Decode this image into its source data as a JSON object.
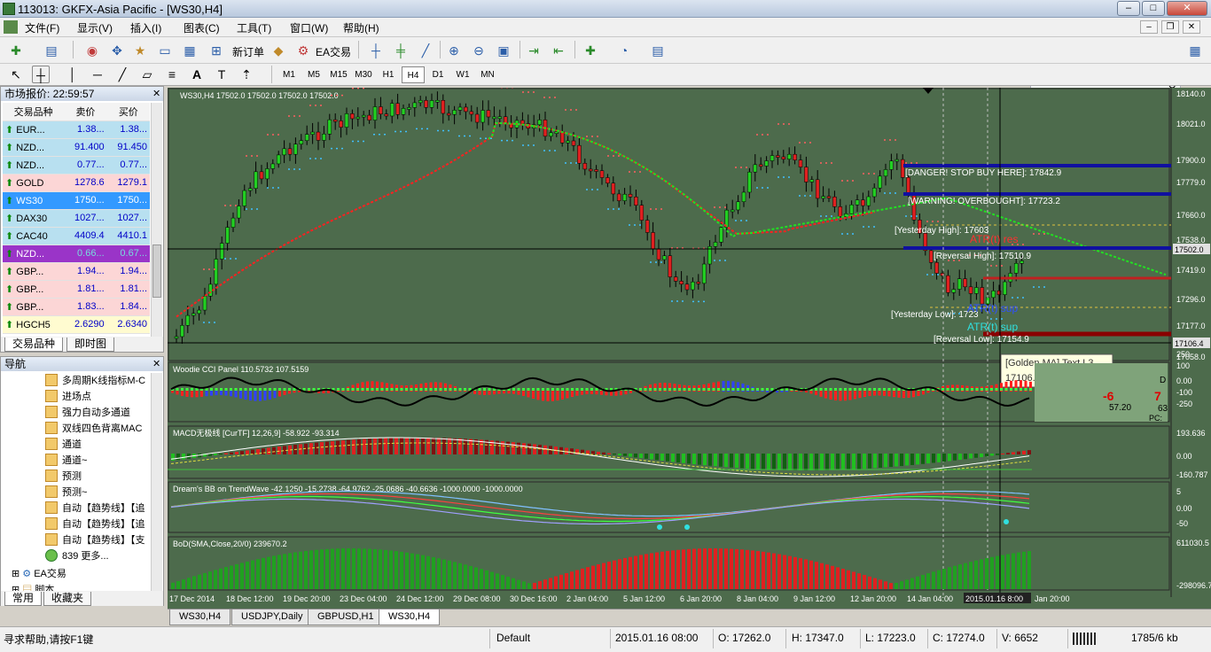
{
  "title": "113013: GKFX-Asia Pacific - [WS30,H4]",
  "menu": [
    "文件(F)",
    "显示(V)",
    "插入(I)",
    "图表(C)",
    "工具(T)",
    "窗口(W)",
    "帮助(H)"
  ],
  "toolbar": {
    "new_order": "新订单",
    "ea_trading": "EA交易"
  },
  "timeframes": [
    "M1",
    "M5",
    "M15",
    "M30",
    "H1",
    "H4",
    "D1",
    "W1",
    "MN"
  ],
  "market_watch": {
    "title": "市场报价: 22:59:57",
    "columns": [
      "交易品种",
      "卖价",
      "买价"
    ],
    "rows": [
      {
        "symbol": "EUR...",
        "bid": "1.38...",
        "ask": "1.38...",
        "bg": "#b8e0f0"
      },
      {
        "symbol": "NZD...",
        "bid": "91.400",
        "ask": "91.450",
        "bg": "#b8e0f0"
      },
      {
        "symbol": "NZD...",
        "bid": "0.77...",
        "ask": "0.77...",
        "bg": "#b8e0f0"
      },
      {
        "symbol": "GOLD",
        "bid": "1278.6",
        "ask": "1279.1",
        "bg": "#fcd6d6"
      },
      {
        "symbol": "WS30",
        "bid": "1750...",
        "ask": "1750...",
        "bg": "#3399ff"
      },
      {
        "symbol": "DAX30",
        "bid": "1027...",
        "ask": "1027...",
        "bg": "#b8e0f0"
      },
      {
        "symbol": "CAC40",
        "bid": "4409.4",
        "ask": "4410.1",
        "bg": "#b8e0f0"
      },
      {
        "symbol": "NZD...",
        "bid": "0.66...",
        "ask": "0.67...",
        "bg": "#9a34c8"
      },
      {
        "symbol": "GBP...",
        "bid": "1.94...",
        "ask": "1.94...",
        "bg": "#fcd6d6"
      },
      {
        "symbol": "GBP...",
        "bid": "1.81...",
        "ask": "1.81...",
        "bg": "#fcd6d6"
      },
      {
        "symbol": "GBP...",
        "bid": "1.83...",
        "ask": "1.84...",
        "bg": "#fcd6d6"
      },
      {
        "symbol": "HGCH5",
        "bid": "2.6290",
        "ask": "2.6340",
        "bg": "#fffbd0"
      }
    ],
    "tabs": [
      "交易品种",
      "即时图"
    ]
  },
  "navigator": {
    "title": "导航",
    "items": [
      "多周期K线指标M-C",
      "进场点",
      "强力自动多通道",
      "双线四色背离MAC",
      "通道",
      "通道~",
      "预测",
      "预测~",
      "自动【趋势线】【追",
      "自动【趋势线】【追",
      "自动【趋势线】【支",
      "839 更多..."
    ],
    "groups": [
      "EA交易",
      "脚本"
    ],
    "tabs": [
      "常用",
      "收藏夹"
    ]
  },
  "chart": {
    "header": "WS30,H4  17502.0 17502.0 17502.0 17502.0",
    "price_ticks": [
      "18140.0",
      "18021.0",
      "17900.0",
      "17779.0",
      "17660.0",
      "17538.0",
      "17502.0",
      "17419.0",
      "17296.0",
      "17177.0",
      "17106.4",
      "17058.0"
    ],
    "labels": {
      "danger": "[DANGER! STOP BUY HERE]: 17842.9",
      "warning": "[WARNING! OVERBOUGHT]: 17723.2",
      "yhigh": "[Yesterday High]: 17603",
      "atr_res": "ATR(t) res",
      "rev_high": "[Reversal High]: 17510.9",
      "ylow": "[Yesterday Low]: 1723",
      "atr_sup1": "ATR(t) sup",
      "atr_sup2": "ATR(t) sup",
      "rev_low": "[Reversal Low]: 17154.9",
      "tooltip1": "[Golden MA] Text L3",
      "tooltip2": "17106.4"
    },
    "cci": {
      "label": "Woodie CCI Panel 110.5732 107.5159",
      "ticks": [
        "250",
        "100",
        "0.00",
        "-100",
        "-250"
      ],
      "box": {
        "a": "-6",
        "b": "7",
        "c": "57.20",
        "d": "63",
        "e": "D",
        "f": "PC:"
      }
    },
    "macd": {
      "label": "MACD无极线 [CurTF] 12,26,9] -58.922 -93.314",
      "ticks": [
        "193.636",
        "0.00",
        "-160.787"
      ]
    },
    "bb": {
      "label": "Dream's BB on TrendWave -42.1250 -15.2738 -64.9762 -25.0686 -40.6636 -1000.0000 -1000.0000",
      "ticks": [
        "5",
        "0.00",
        "-50"
      ]
    },
    "bod": {
      "label": "BoD(SMA,Close,20/0) 239670.2",
      "ticks": [
        "611030.5",
        "-298096.7"
      ]
    },
    "time_ticks": [
      "17 Dec 2014",
      "18 Dec 12:00",
      "19 Dec 20:00",
      "23 Dec 04:00",
      "24 Dec 12:00",
      "29 Dec 08:00",
      "30 Dec 16:00",
      "2 Jan 04:00",
      "5 Jan 12:00",
      "6 Jan 20:00",
      "8 Jan 04:00",
      "9 Jan 12:00",
      "12 Jan 20:00",
      "14 Jan 04:00",
      "2015.01.16 8:00",
      "Jan 20:00"
    ]
  },
  "chart_tabs": [
    "WS30,H4",
    "USDJPY,Daily",
    "GBPUSD,H1",
    "WS30,H4"
  ],
  "status": {
    "help": "寻求帮助,请按F1键",
    "profile": "Default",
    "time": "2015.01.16 08:00",
    "open": "O: 17262.0",
    "high": "H: 17347.0",
    "low": "L: 17223.0",
    "close": "C: 17274.0",
    "volume": "V: 6652",
    "traffic": "1785/6 kb"
  }
}
